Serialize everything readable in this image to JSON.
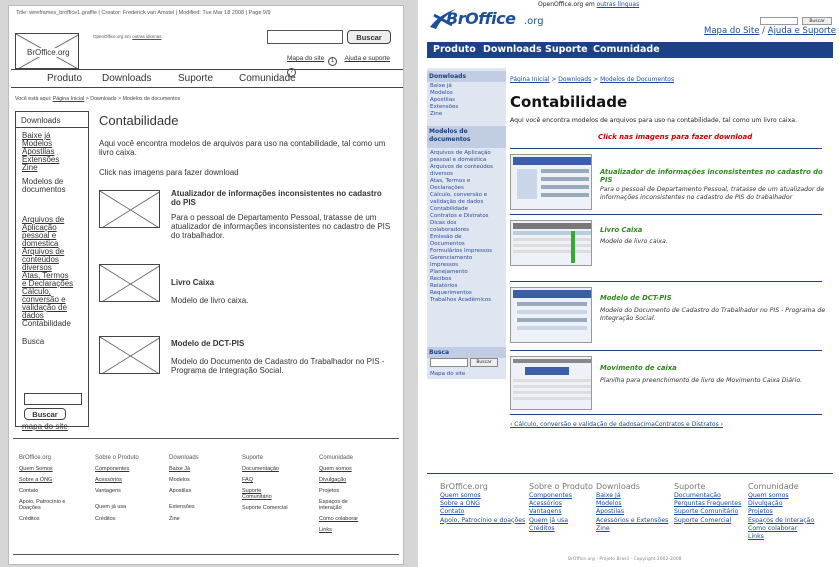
{
  "wireframe": {
    "meta": "Title: wireframes_broffice1.graffle  |  Creator: Frederick van Amstel  |  Modified: Tue Mar 18 2008  |  Page 9/9",
    "logo": "BrOffice.org",
    "lang_prefix": "OpenOffice.org em ",
    "lang_link": "outras idiomas",
    "search_button": "Buscar",
    "sitemap": "Mapa do site",
    "help": "Ajuda e suporte",
    "help_icon": "?",
    "nav": [
      "Produto",
      "Downloads",
      "Suporte",
      "Comunidade"
    ],
    "crumb_prefix": "Você está aqui: ",
    "crumb": [
      "Página Inicial",
      "Downloads",
      "Modelos de documentos"
    ],
    "side": {
      "heading": "Downloads",
      "links": [
        "Baixe já",
        "Modelos",
        "Apostilas",
        "Extensões",
        "Zine"
      ],
      "section": [
        "Modelos de",
        "documentos"
      ],
      "links2": [
        "Arquivos de",
        "Aplicação",
        "pessoal e",
        "domestica",
        "Arquivos de",
        "conteúdos",
        "diversos",
        "Atas, Termos",
        "e Declarações",
        "Cálculo,",
        "conversão e",
        "validação de",
        "dados",
        "Contabilidade"
      ],
      "search_label": "Busca",
      "search_button": "Buscar",
      "map": "mapa do site"
    },
    "title": "Contabilidade",
    "intro": "Aqui você encontra modelos de arquivos para uso na contabilidade, tal como um livro caixa.",
    "click": "Click nas imagens para fazer download",
    "items": [
      {
        "title": "Atualizador de informações inconsistentes no cadastro do PIS",
        "desc": "Para o pessoal de Departamento Pessoal, tratasse de um atualizador de informações inconsistentes no cadastro de PIS do trabalhador."
      },
      {
        "title": "Livro Caixa",
        "desc": "Modelo de livro caixa."
      },
      {
        "title": "Modelo de DCT-PIS",
        "desc": "Modelo do Documento de Cadastro do Trabalhador no PIS - Programa de Integração Social."
      }
    ],
    "footer": [
      {
        "head": "BrOffice.org",
        "links": [
          "Quem Somos",
          "Sobre a ONG",
          "Contato",
          "Apoio, Patrocínio e Doações",
          "Créditos"
        ]
      },
      {
        "head": "Sobre o Produto",
        "links": [
          "Componentes",
          "Acessórios",
          "Vantagens",
          "Quem já usa",
          "Créditos"
        ]
      },
      {
        "head": "Downloads",
        "links": [
          "Baixe Já",
          "Modelos",
          "Apostilas",
          "Extensões",
          "Zine"
        ]
      },
      {
        "head": "Suporte",
        "links": [
          "Documentação",
          "FAQ",
          "Suporte Comunitário",
          "Suporte Comercial"
        ]
      },
      {
        "head": "Comunidade",
        "links": [
          "Quem somos",
          "Divulgação",
          "Projetos",
          "Espaços de interação",
          "Como colaborar",
          "Links"
        ]
      }
    ]
  },
  "site": {
    "lang_prefix": "OpenOffice.org em ",
    "lang_link": "outras línguas",
    "logo_main": "BrOffice",
    "logo_suffix": ".org",
    "search_button": "Buscar",
    "sitemap": "Mapa do Site",
    "help": "Ajuda e Suporte",
    "nav": [
      "Produto",
      "Downloads",
      "Suporte",
      "Comunidade"
    ],
    "side": {
      "heading": "Donwloads",
      "links": [
        "Baixe já",
        "Modelos",
        "Apostilas",
        "Extensões",
        "Zine"
      ],
      "section": "Modelos de documentos",
      "links2": [
        "Arquivos de Aplicação",
        "pessoal e doméstica",
        "Arquivos de conteúdos",
        "diversos",
        "Atas, Termos e",
        "Declarações",
        "Cálculo, conversão e",
        "validação de dados",
        "Contabilidade",
        "Contratos e Distratos",
        "Dicas dos",
        "colaboradores",
        "Emissão de",
        "Documentos",
        "Formulários Impressos",
        "Gerenciamento",
        "Impressos",
        "Planejamento",
        "Recibos",
        "Relatórios",
        "Requerimentos",
        "Trabalhos Acadêmicos"
      ],
      "search_head": "Busca",
      "search_button": "Buscar",
      "map": "Mapa do site"
    },
    "crumb": [
      "Página Inicial",
      "Downloads",
      "Modelos de Documentos"
    ],
    "title": "Contabilidade",
    "intro": "Aqui você encontra modelos de arquivos para uso na contabilidade, tal como um livro caixa.",
    "click": "Click nas imagens para fazer download",
    "items": [
      {
        "title": "Atualizador de informações inconsistentes no cadastro do PIS",
        "desc": "Para o pessoal de Departamento Pessoal, tratasse de um atualizador de informações inconsistentes no cadastro de PIS do trabalhador"
      },
      {
        "title": "Livro Caixa",
        "desc": "Modelo de livro caixa."
      },
      {
        "title": "Modelo de DCT-PIS",
        "desc": "Modelo do Documento de Cadastro do Trabalhador no PIS - Programa de Integração Social."
      },
      {
        "title": "Movimento de caixa",
        "desc": "Planilha para preenchimento de livro de Movimento Caixa Diário."
      }
    ],
    "pager": "‹ Cálculo, conversão e validação de dadosacimaContratos e Distratos ›",
    "footer": [
      {
        "head": "BrOffice.org",
        "links": [
          "Quem somos",
          "Sobre a ONG",
          "Contato",
          "Apoio, Patrocínio e doações"
        ]
      },
      {
        "head": "Sobre o Produto",
        "links": [
          "Componentes",
          "Acessórios",
          "Vantagens",
          "Quem já usa",
          "Créditos"
        ]
      },
      {
        "head": "Downloads",
        "links": [
          "Baixe Já",
          "Modelos",
          "Apostilas",
          "Acessórios e Extensões",
          "Zine"
        ]
      },
      {
        "head": "Suporte",
        "links": [
          "Documentação",
          "Perguntas Frequentes",
          "Suporte Comunitário",
          "Suporte Comercial"
        ]
      },
      {
        "head": "Comunidade",
        "links": [
          "Quem somos",
          "Divulgação",
          "Projetos",
          "Espaços de Interação",
          "Como colaborar",
          "Links"
        ]
      }
    ],
    "copyright": "BrOffice.org - Projeto Brasil - Copyright 2002-2008"
  },
  "colors": {
    "nav_blue": "#1d4189",
    "logo_blue": "#1d4f98",
    "item_green": "#2f8a1c",
    "click_red": "#cc0000"
  }
}
